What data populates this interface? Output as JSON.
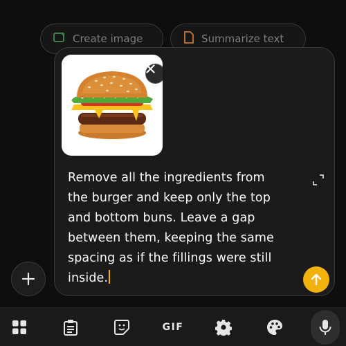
{
  "suggestion_chips": [
    {
      "label": "Create image",
      "icon": "image-spark-icon"
    },
    {
      "label": "Summarize text",
      "icon": "document-icon"
    }
  ],
  "composer": {
    "attachment": {
      "icon": "burger-image"
    },
    "prompt_text": "Remove all the ingredients from the burger and keep only the top and bottom buns. Leave a gap between them, keeping the same spacing as if the fillings were still inside.",
    "accent_color": "#f2b20d"
  },
  "toolbar": {
    "items": [
      {
        "name": "apps",
        "icon": "grid-icon"
      },
      {
        "name": "clipboard",
        "icon": "clipboard-icon"
      },
      {
        "name": "stickers",
        "icon": "sticker-icon"
      },
      {
        "name": "gif",
        "label": "GIF"
      },
      {
        "name": "settings",
        "icon": "gear-icon"
      },
      {
        "name": "themes",
        "icon": "palette-icon"
      },
      {
        "name": "voice",
        "icon": "mic-icon"
      }
    ]
  }
}
